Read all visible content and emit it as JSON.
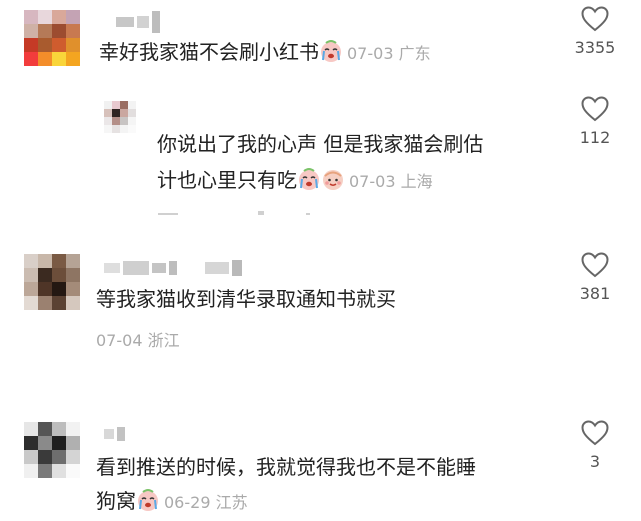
{
  "comments": [
    {
      "text": "幸好我家猫不会刷小红书",
      "date": "07-03",
      "location": "广东",
      "likes": "3355",
      "emojis": [
        "crying-face"
      ]
    },
    {
      "text_line1": "你说出了我的心声 但是我家猫会刷估",
      "text_line2": "计也心里只有吃",
      "date": "07-03",
      "location": "上海",
      "likes": "112",
      "emojis": [
        "crying-face",
        "smiling-face"
      ]
    },
    {
      "text": "等我家猫收到清华录取通知书就买",
      "date": "07-04",
      "location": "浙江",
      "likes": "381"
    },
    {
      "text_line1": "看到推送的时候，我就觉得我也不是不能睡",
      "text_line2": "狗窝",
      "date": "06-29",
      "location": "江苏",
      "likes": "3",
      "emojis": [
        "crying-face"
      ]
    }
  ],
  "colors": {
    "text": "#222222",
    "meta": "#aaaaaa",
    "count": "#555555",
    "heart_stroke": "#666666"
  }
}
